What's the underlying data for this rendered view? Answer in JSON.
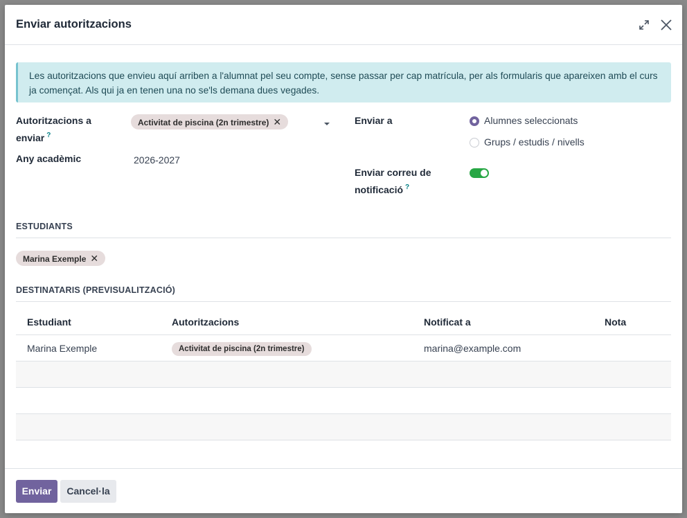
{
  "dialog": {
    "title": "Enviar autoritzacions",
    "expand_icon": "expand-icon",
    "close_icon": "close-icon"
  },
  "alert": {
    "text": "Les autoritzacions que envieu aquí arriben a l'alumnat pel seu compte, sense passar per cap matrícula, per als formularis que apareixen amb el curs ja començat. Als qui ja en tenen una no se'ls demana dues vegades."
  },
  "form": {
    "authorizations_label_line1": "Autoritzacions a",
    "authorizations_label_line2": "enviar",
    "help_mark": "?",
    "authorizations_tag": "Activitat de piscina (2n trimestre)",
    "tag_remove": "✕",
    "year_label": "Any acadèmic",
    "year_value": "2026-2027",
    "send_to_label": "Enviar a",
    "send_to_options": [
      "Alumnes seleccionats",
      "Grups / estudis / nivells"
    ],
    "send_to_selected": "Alumnes seleccionats",
    "notify_label_line1": "Enviar correu de",
    "notify_label_line2": "notificació",
    "notify_enabled": true
  },
  "students": {
    "section_title": "ESTUDIANTS",
    "tags": [
      "Marina Exemple"
    ]
  },
  "recipients": {
    "section_title": "DESTINATARIS (PREVISUALITZACIÓ)",
    "columns": [
      "Estudiant",
      "Autoritzacions",
      "Notificat a",
      "Nota"
    ],
    "rows": [
      {
        "student": "Marina Exemple",
        "authorization": "Activitat de piscina (2n trimestre)",
        "notified_to": "marina@example.com",
        "note": ""
      }
    ]
  },
  "footer": {
    "send_label": "Enviar",
    "cancel_label": "Cancel·la"
  },
  "colors": {
    "primary": "#71639e",
    "alert_bg": "#d0ecef",
    "toggle_on": "#28a745",
    "tag_bg": "#e6dcdc"
  }
}
